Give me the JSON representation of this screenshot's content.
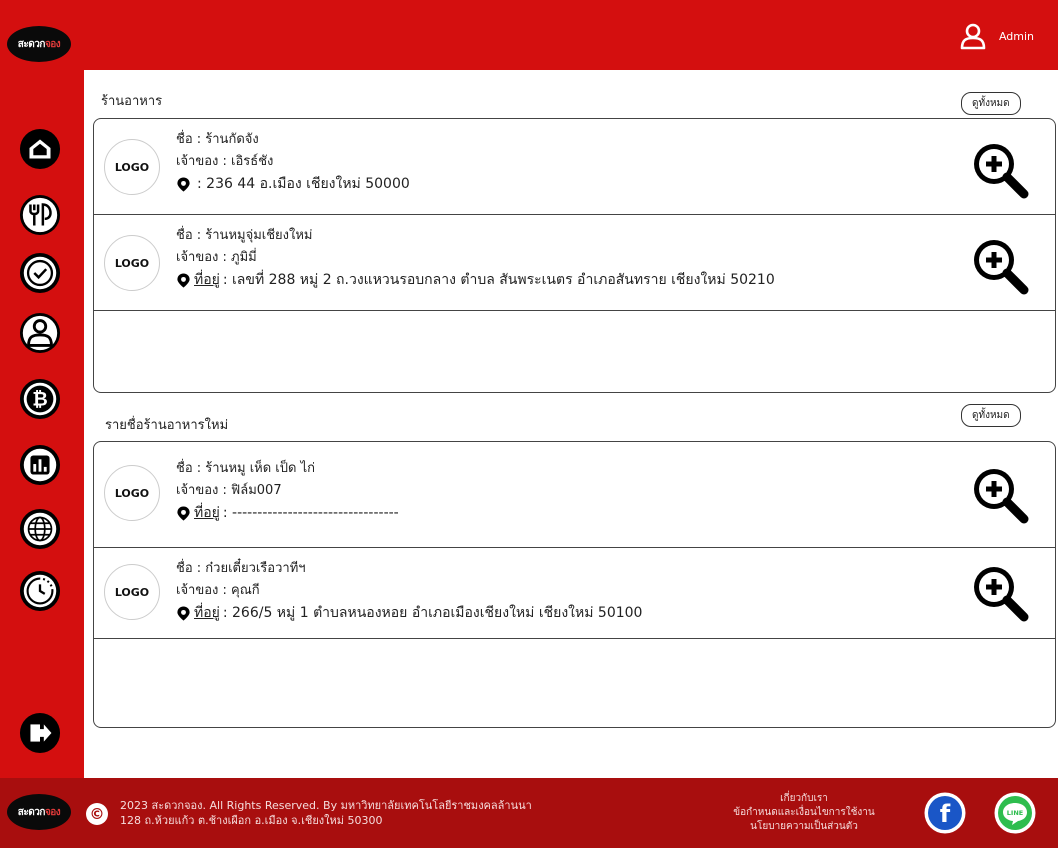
{
  "brand": {
    "logo_main": "สะดวก",
    "logo_accent": "จอง"
  },
  "header": {
    "user_label": "Admin"
  },
  "colors": {
    "primary": "#d40f0f",
    "footer": "#a80e0e",
    "facebook": "#1a56c7",
    "line": "#2ebd4e"
  },
  "sidebar": {
    "items": [
      {
        "icon": "home-icon"
      },
      {
        "icon": "food-menu-icon"
      },
      {
        "icon": "check-icon"
      },
      {
        "icon": "user-icon"
      },
      {
        "icon": "bitcoin-icon"
      },
      {
        "icon": "chart-icon"
      },
      {
        "icon": "globe-icon"
      },
      {
        "icon": "history-icon"
      },
      {
        "icon": "logout-icon"
      }
    ]
  },
  "restaurants": {
    "title": "ร้านอาหาร",
    "see_all": "ดูทั้งหมด",
    "rows": [
      {
        "logo": "LOGO",
        "name": "ชื่อ : ร้านกัดจัง",
        "owner": "เจ้าของ : เอิรธ์ชัง",
        "addr_label": "",
        "address": ": 236 44 อ.เมือง เชียงใหม่ 50000"
      },
      {
        "logo": "LOGO",
        "name": "ชื่อ : ร้านหมูจุ่มเชียงใหม่",
        "owner": "เจ้าของ : ภูมิมี่",
        "addr_label": "ที่อยู่",
        "address": ": เลขที่ 288 หมู่ 2 ถ.วงแหวนรอบกลาง ตำบล สันพระเนตร อำเภอสันทราย เชียงใหม่ 50210"
      }
    ]
  },
  "new_restaurants": {
    "title": "รายชื่อร้านอาหารใหม่",
    "see_all": "ดูทั้งหมด",
    "rows": [
      {
        "logo": "LOGO",
        "name": "ชื่อ : ร้านหมู เห็ด เป็ด ไก่",
        "owner": "เจ้าของ : ฟิล์ม007",
        "addr_label": "ที่อยู่",
        "address": ": ---------------------------------"
      },
      {
        "logo": "LOGO",
        "name": "ชื่อ : ก๋วยเตี๋ยวเรือวาทีฯ",
        "owner": "เจ้าของ : คุณกี",
        "addr_label": "ที่อยู่",
        "address": ": 266/5 หมู่ 1 ตำบลหนองหอย อำเภอเมืองเชียงใหม่ เชียงใหม่ 50100"
      }
    ]
  },
  "footer": {
    "copyright_symbol": "©",
    "copyright_line1": "2023 สะดวกจอง. All Rights Reserved. By มหาวิทยาลัยเทคโนโลยีราชมงคลล้านนา",
    "copyright_line2": "128 ถ.ห้วยแก้ว ต.ช้างเผือก อ.เมือง จ.เชียงใหม่ 50300",
    "about": "เกี่ยวกับเรา",
    "terms": "ข้อกำหนดและเงื่อนไขการใช้งาน",
    "privacy": "นโยบายความเป็นส่วนตัว",
    "facebook_glyph": "f",
    "line_glyph": "LINE"
  }
}
